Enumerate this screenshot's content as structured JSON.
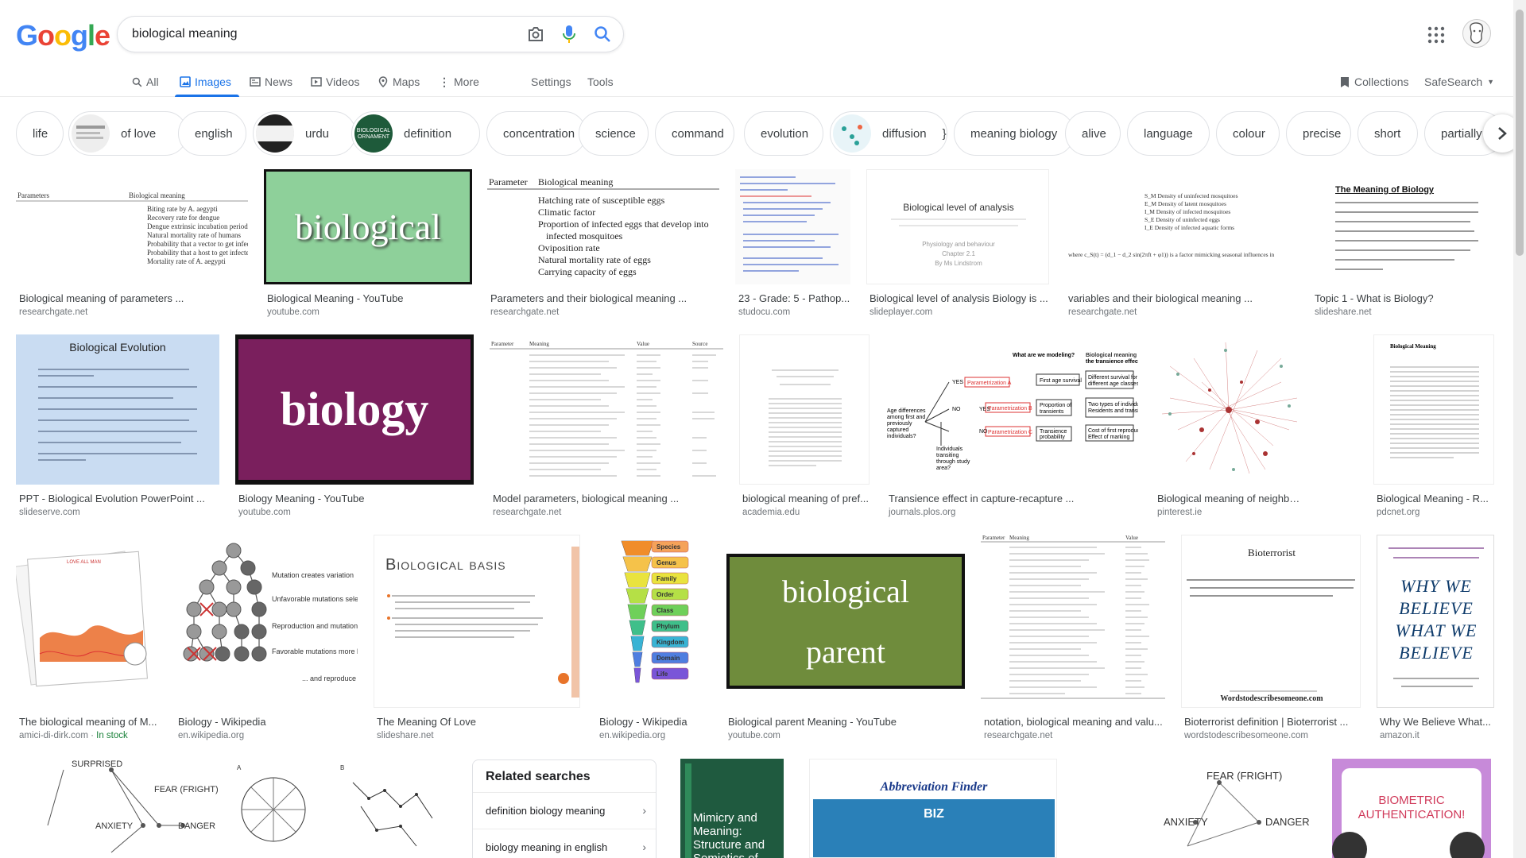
{
  "logo": [
    "G",
    "o",
    "o",
    "g",
    "l",
    "e"
  ],
  "logo_colors": [
    "#4285F4",
    "#EA4335",
    "#FBBC05",
    "#4285F4",
    "#34A853",
    "#EA4335"
  ],
  "search": {
    "query": "biological meaning"
  },
  "icons": {
    "camera": "camera-icon",
    "mic": "microphone-icon",
    "search": "search-icon",
    "apps": "apps-grid-icon"
  },
  "tabs": [
    {
      "label": "All",
      "icon": "search-icon",
      "active": false
    },
    {
      "label": "Images",
      "icon": "image-icon",
      "active": true
    },
    {
      "label": "News",
      "icon": "news-icon",
      "active": false
    },
    {
      "label": "Videos",
      "icon": "video-icon",
      "active": false
    },
    {
      "label": "Maps",
      "icon": "map-pin-icon",
      "active": false
    },
    {
      "label": "More",
      "icon": "more-vert-icon",
      "active": false
    }
  ],
  "tools": {
    "settings": "Settings",
    "tools": "Tools",
    "collections": "Collections",
    "safesearch": "SafeSearch"
  },
  "chips": [
    "life",
    "of love",
    "english",
    "urdu",
    "definition",
    "concentration",
    "science",
    "command",
    "evolution",
    "diffusion",
    "meaning biology",
    "alive",
    "language",
    "colour",
    "precise",
    "short",
    "partially"
  ],
  "results": [
    {
      "title": "Biological meaning of parameters ...",
      "site": "researchgate.net"
    },
    {
      "title": "Biological Meaning - YouTube",
      "site": "youtube.com",
      "text": "biological"
    },
    {
      "title": "Parameters and their biological meaning ...",
      "site": "researchgate.net"
    },
    {
      "title": "23 - Grade: 5 - Pathop...",
      "site": "studocu.com"
    },
    {
      "title": "Biological level of analysis Biology is ...",
      "site": "slideplayer.com",
      "text": "Biological level of analysis"
    },
    {
      "title": "variables and their biological meaning ...",
      "site": "researchgate.net"
    },
    {
      "title": "Topic 1 - What is Biology?",
      "site": "slideshare.net",
      "text": "The Meaning of Biology"
    },
    {
      "title": "PPT - Biological Evolution PowerPoint ...",
      "site": "slideserve.com",
      "text": "Biological Evolution"
    },
    {
      "title": "Biology Meaning - YouTube",
      "site": "youtube.com",
      "text": "biology"
    },
    {
      "title": "Model parameters, biological meaning ...",
      "site": "researchgate.net"
    },
    {
      "title": "biological meaning of pref...",
      "site": "academia.edu"
    },
    {
      "title": "Transience effect in capture-recapture ...",
      "site": "journals.plos.org"
    },
    {
      "title": "Biological meaning of neighbourhoods ...",
      "site": "pinterest.ie"
    },
    {
      "title": "Biological Meaning - R...",
      "site": "pdcnet.org"
    },
    {
      "title": "The biological meaning of M...",
      "site": "amici-di-dirk.com",
      "stock": "In stock"
    },
    {
      "title": "Biology - Wikipedia",
      "site": "en.wikipedia.org"
    },
    {
      "title": "The Meaning Of Love",
      "site": "slideshare.net",
      "text": "Biological basis"
    },
    {
      "title": "Biology - Wikipedia",
      "site": "en.wikipedia.org"
    },
    {
      "title": "Biological parent Meaning - YouTube",
      "site": "youtube.com",
      "text": "biological",
      "text2": "parent"
    },
    {
      "title": "notation, biological meaning and valu...",
      "site": "researchgate.net"
    },
    {
      "title": "Bioterrorist definition | Bioterrorist ...",
      "site": "wordstodescribesomeone.com",
      "text": "Bioterrorist",
      "text2": "Wordstodescribesomeone.com"
    },
    {
      "title": "Why We Believe What...",
      "site": "amazon.it",
      "text": "WHY WE BELIEVE WHAT WE BELIEVE"
    }
  ],
  "related": {
    "heading": "Related searches",
    "items": [
      "definition biology meaning",
      "biology meaning in english"
    ]
  },
  "bottom_images": {
    "surprised": "SURPRISED",
    "fear": "FEAR (FRIGHT)",
    "anxiety": "ANXIETY",
    "danger": "DANGER",
    "book": "Mimicry and Meaning: Structure and Semiotics of",
    "abbr": "Abbreviation Finder",
    "biz": "BIZ",
    "biometric": "BIOMETRIC AUTHENTICATION!"
  },
  "levels": [
    "Species",
    "Genus",
    "Family",
    "Order",
    "Class",
    "Phylum",
    "Kingdom",
    "Domain",
    "Life"
  ],
  "mutation_labels": [
    "Mutation creates variation",
    "Unfavorable mutations selected against",
    "Reproduction and mutation occur",
    "Favorable mutations more likely to survive",
    "... and reproduce"
  ]
}
